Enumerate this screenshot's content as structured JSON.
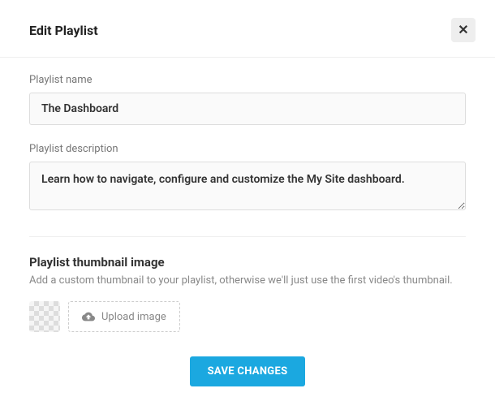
{
  "header": {
    "title": "Edit Playlist"
  },
  "form": {
    "name": {
      "label": "Playlist name",
      "value": "The Dashboard"
    },
    "description": {
      "label": "Playlist description",
      "value": "Learn how to navigate, configure and customize the My Site dashboard."
    }
  },
  "thumbnail": {
    "title": "Playlist thumbnail image",
    "subtitle": "Add a custom thumbnail to your playlist, otherwise we'll just use the first video's thumbnail.",
    "upload_label": "Upload image"
  },
  "footer": {
    "save_label": "SAVE CHANGES"
  }
}
